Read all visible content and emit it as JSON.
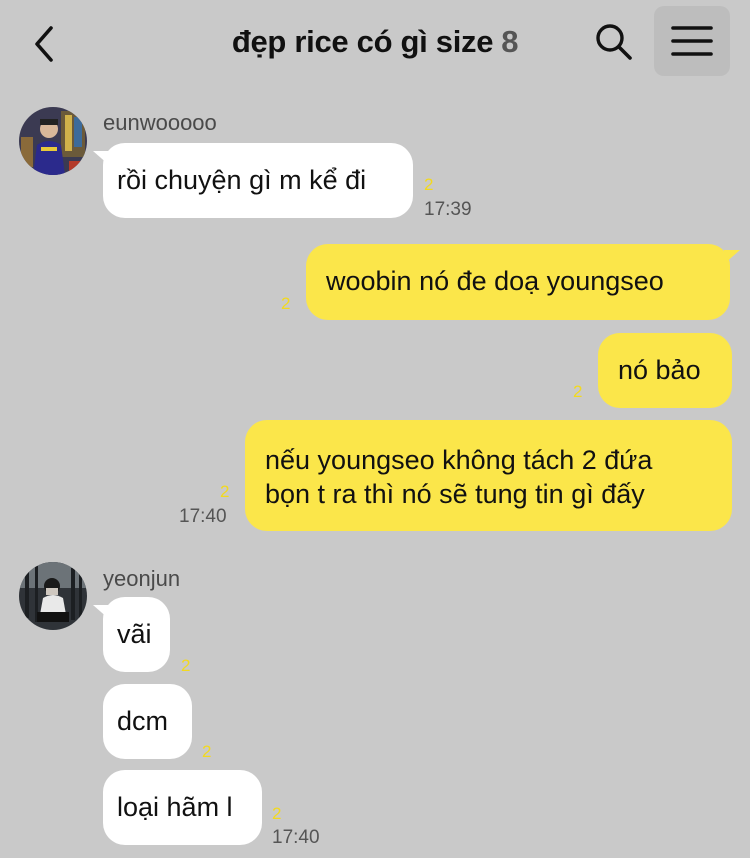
{
  "header": {
    "title": "đẹp rice có gì size",
    "member_count": "8",
    "icons": {
      "back": "chevron-left-icon",
      "search": "search-icon",
      "menu": "hamburger-menu-icon"
    }
  },
  "colors": {
    "background": "#c9c9c9",
    "my_bubble": "#fbe64a",
    "their_bubble": "#ffffff",
    "unread": "#f2d920"
  },
  "messages": [
    {
      "sender": "eunwooooo",
      "text": "rồi chuyện gì m kể đi",
      "unread": "2",
      "time": "17:39"
    },
    {
      "sender": "me",
      "text": "woobin nó đe doạ youngseo",
      "unread": "2"
    },
    {
      "sender": "me",
      "text": "nó bảo",
      "unread": "2"
    },
    {
      "sender": "me",
      "text_lines": [
        "nếu youngseo không tách 2 đứa",
        "bọn t ra thì nó sẽ tung tin gì đấy"
      ],
      "unread": "2",
      "time": "17:40"
    },
    {
      "sender": "yeonjun",
      "text": "vãi",
      "unread": "2"
    },
    {
      "sender": "yeonjun",
      "text": "dcm",
      "unread": "2"
    },
    {
      "sender": "yeonjun",
      "text": "loại hãm l",
      "unread": "2",
      "time": "17:40"
    }
  ]
}
